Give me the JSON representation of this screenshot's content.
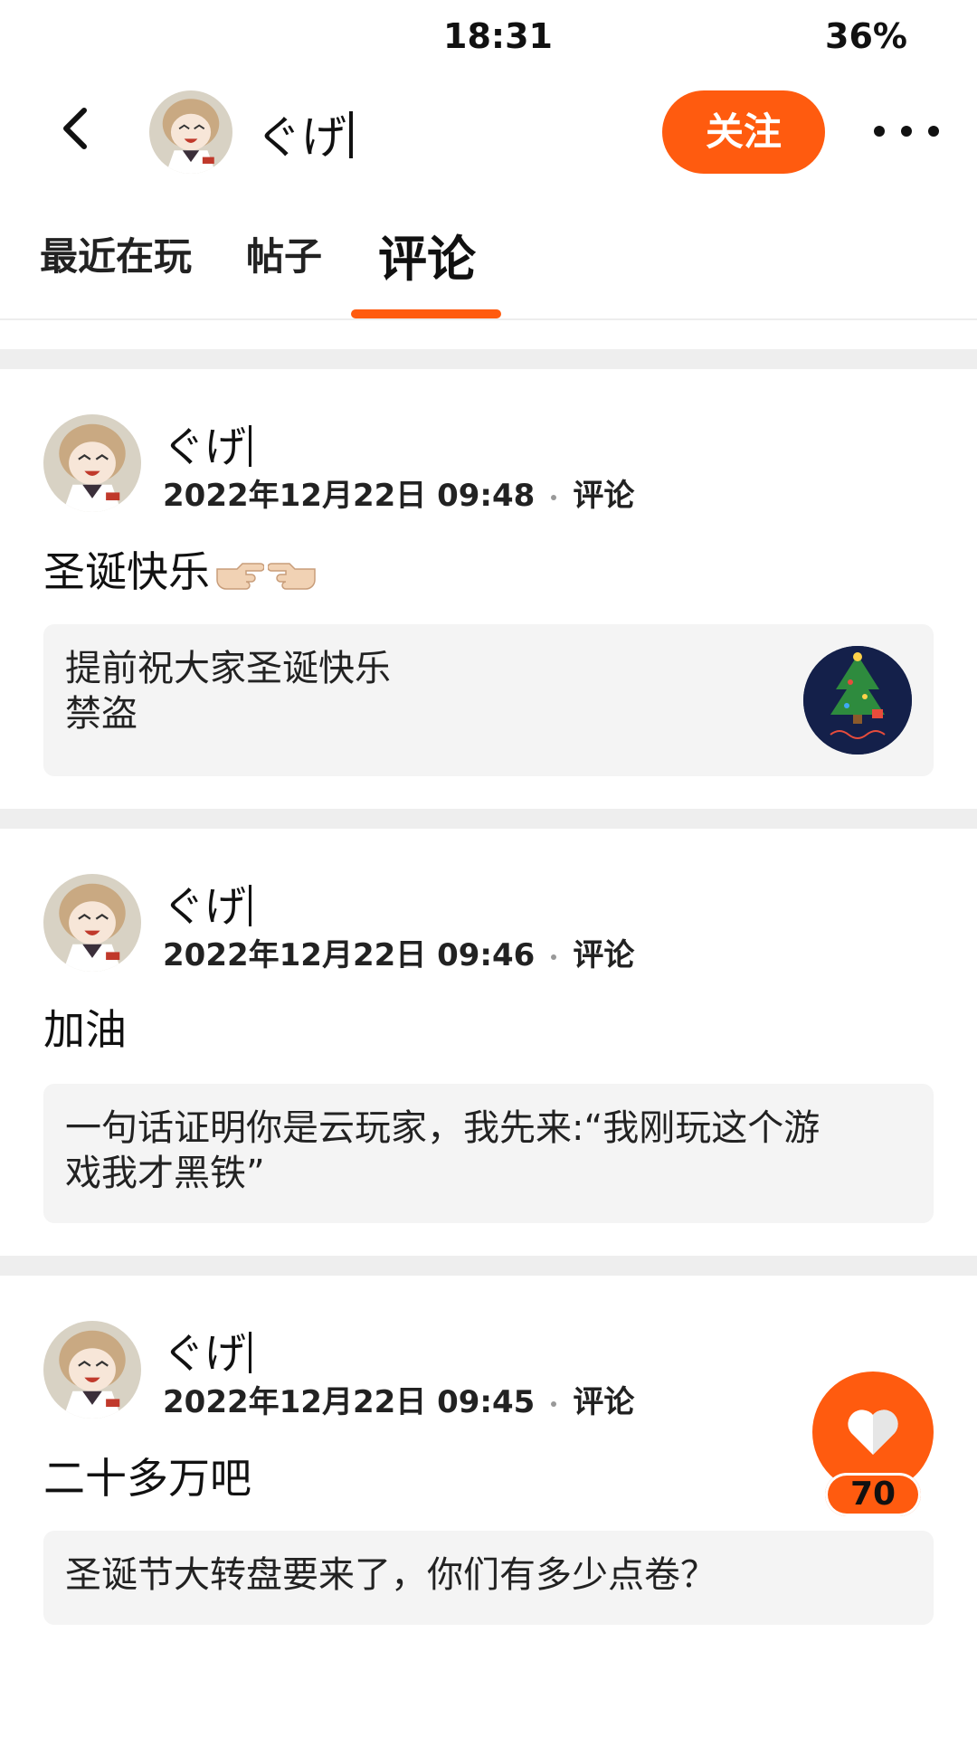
{
  "status_bar": {
    "time": "18:31",
    "battery": "36%"
  },
  "header": {
    "username": "ぐげ",
    "follow_label": "关注"
  },
  "tabs": [
    {
      "label": "最近在玩"
    },
    {
      "label": "帖子"
    },
    {
      "label": "评论",
      "active": true
    }
  ],
  "posts": [
    {
      "author": "ぐげ",
      "date": "2022年12月22日 09:48",
      "type": "评论",
      "comment": "圣诞快乐",
      "quote_line1": "提前祝大家圣诞快乐",
      "quote_line2": "禁盗",
      "has_thumbnail": true
    },
    {
      "author": "ぐげ",
      "date": "2022年12月22日 09:46",
      "type": "评论",
      "comment": "加油",
      "quote_line1": "一句话证明你是云玩家，我先来:“我刚玩这个游",
      "quote_line2": "戏我才黑铁”"
    },
    {
      "author": "ぐげ",
      "date": "2022年12月22日 09:45",
      "type": "评论",
      "comment": "二十多万吧",
      "quote_line1": "圣诞节大转盘要来了，你们有多少点卷？"
    }
  ],
  "like": {
    "count": "70"
  },
  "colors": {
    "accent": "#ff5b0f",
    "separator": "#eeeeee",
    "quote_bg": "#f4f4f4"
  }
}
